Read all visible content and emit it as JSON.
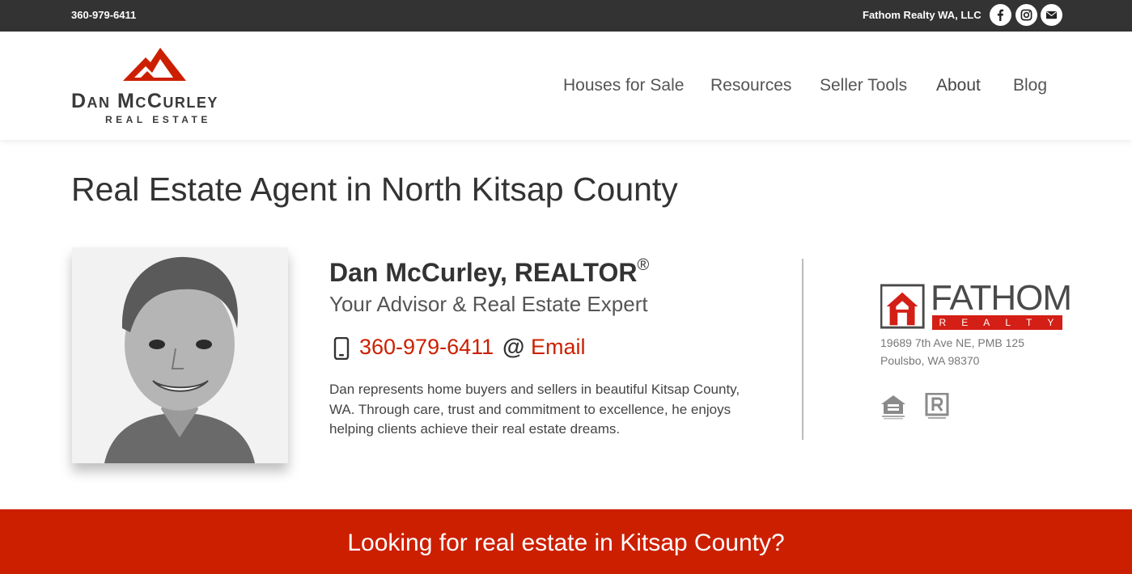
{
  "topbar": {
    "phone": "360-979-6411",
    "company": "Fathom Realty WA, LLC",
    "social": [
      {
        "name": "facebook-icon"
      },
      {
        "name": "instagram-icon"
      },
      {
        "name": "email-icon"
      }
    ]
  },
  "logo": {
    "name": "Dan McCurley",
    "sub": "REAL ESTATE"
  },
  "nav": {
    "items": [
      {
        "label": "Houses for Sale"
      },
      {
        "label": "Resources"
      },
      {
        "label": "Seller Tools"
      },
      {
        "label": "About",
        "active": true
      },
      {
        "label": "Blog"
      }
    ]
  },
  "page": {
    "title": "Real Estate Agent in North Kitsap County"
  },
  "agent": {
    "name": "Dan McCurley, REALTOR",
    "registered": "®",
    "tagline": "Your Advisor & Real Estate Expert",
    "phone": "360-979-6411",
    "at_symbol": "@",
    "email_label": "Email",
    "bio": "Dan represents home buyers and sellers in beautiful Kitsap County, WA. Through care, trust and commitment to excellence, he enjoys helping clients achieve their real estate dreams."
  },
  "brokerage": {
    "logo_word": "FATHOM",
    "logo_sub": [
      "R",
      "E",
      "A",
      "L",
      "T",
      "Y"
    ],
    "address_line1": "19689 7th Ave NE, PMB 125",
    "address_line2": "Poulsbo, WA 98370"
  },
  "banner": {
    "text": "Looking for real estate in Kitsap County?"
  },
  "colors": {
    "accent": "#cc1f00",
    "topbar": "#333333"
  }
}
